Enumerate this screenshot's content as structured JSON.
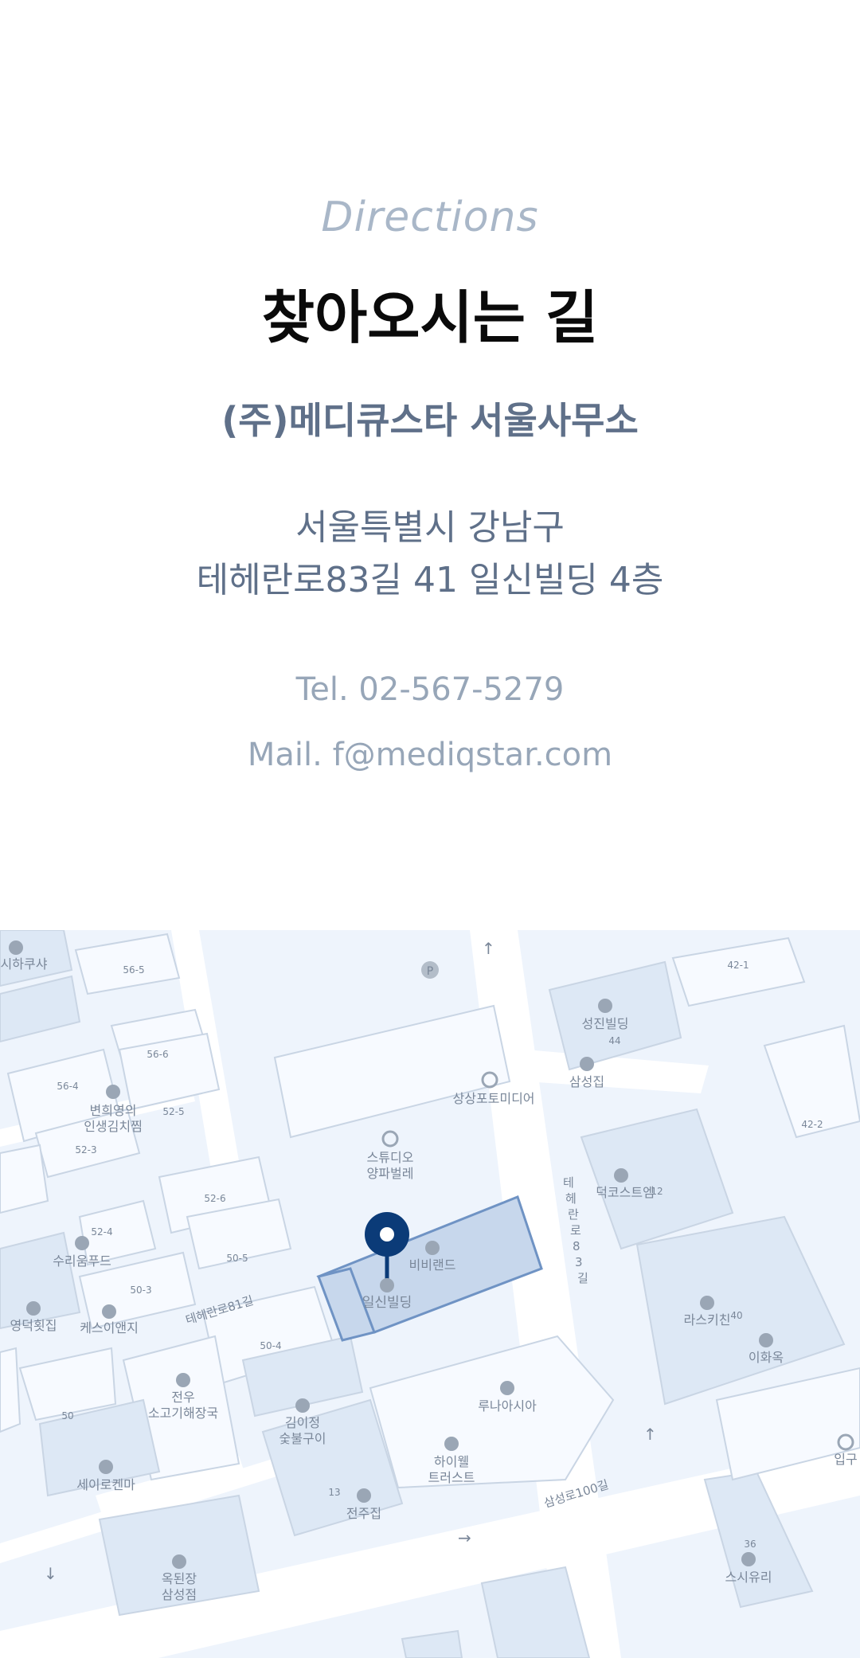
{
  "heading": {
    "english": "Directions",
    "korean": "찾아오시는 길"
  },
  "company": "(주)메디큐스타 서울사무소",
  "address": {
    "line1": "서울특별시 강남구",
    "line2": "테헤란로83길 41 일신빌딩 4층"
  },
  "contact": {
    "tel": "Tel. 02-567-5279",
    "mail": "Mail. f@mediqstar.com"
  },
  "map": {
    "marker_label": "일신빌딩",
    "streets": [
      "테헤란로81길",
      "삼성로100길",
      "테헤란로83길"
    ],
    "places": [
      "시하쿠샤",
      "56-5",
      "56-6",
      "56-4",
      "변희영의",
      "인생김치찜",
      "52-5",
      "52-3",
      "스튜디오",
      "양파벌레",
      "상상포토미디어",
      "52-6",
      "52-4",
      "수리움푸드",
      "50-5",
      "50-3",
      "영덕횟집",
      "케스이앤지",
      "50-4",
      "비비랜드",
      "성진빌딩",
      "44",
      "삼성집",
      "42-1",
      "42-2",
      "덕코스트엠",
      "12",
      "라스키친",
      "40",
      "이화옥",
      "50",
      "전우",
      "소고기해장국",
      "김이정",
      "숯불구이",
      "루나아시아",
      "하이웰",
      "트러스트",
      "13",
      "전주집",
      "세이로켄마",
      "옥된장",
      "삼성점",
      "36",
      "스시유리",
      "입구"
    ]
  },
  "colors": {
    "heading_en": "#a9b7c8",
    "heading_ko": "#0a0a0a",
    "company": "#5f7089",
    "address": "#5f7089",
    "contact": "#97a6b8",
    "map_bg": "#eef4fc",
    "marker": "#0b3b78"
  }
}
